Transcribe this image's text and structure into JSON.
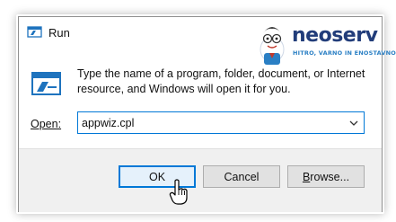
{
  "window": {
    "title": "Run"
  },
  "brand": {
    "name": "neoserv",
    "tagline": "HITRO, VARNO IN ENOSTAVNO",
    "color": "#223d7a",
    "tag_color": "#2a7fc4"
  },
  "dialog": {
    "description": "Type the name of a program, folder, document, or Internet resource, and Windows will open it for you.",
    "open_label": "Open:",
    "open_value": "appwiz.cpl"
  },
  "buttons": {
    "ok": "OK",
    "cancel": "Cancel",
    "browse_prefix": "B",
    "browse_rest": "rowse..."
  },
  "colors": {
    "accent": "#0078d7",
    "footer_bg": "#f0f0f0"
  },
  "icons": [
    "run-icon",
    "mascot-icon",
    "chevron-down-icon",
    "hand-cursor-icon"
  ]
}
